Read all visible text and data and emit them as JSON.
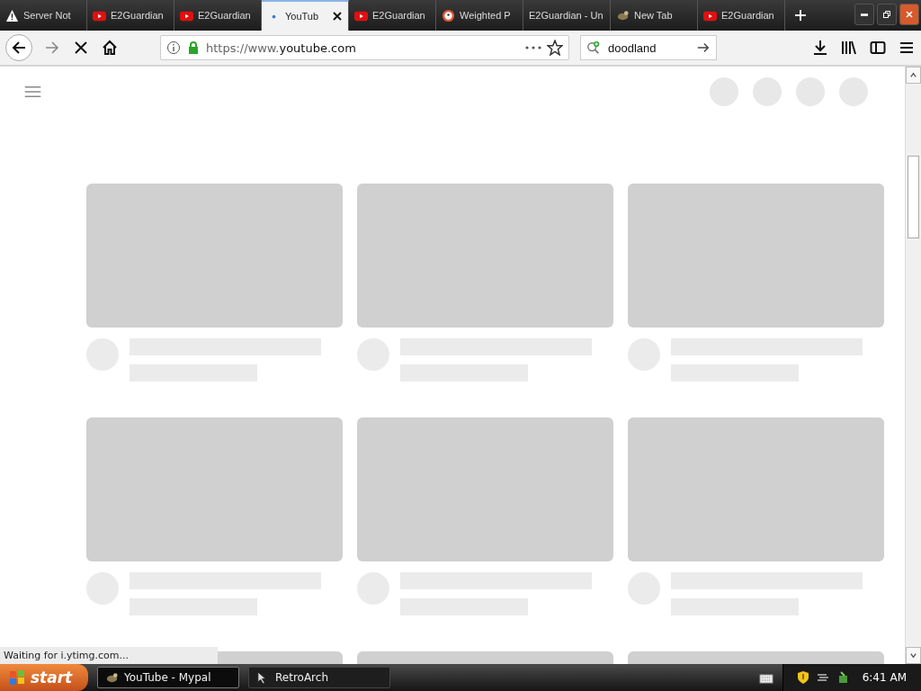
{
  "tabs": [
    {
      "label": "Server Not",
      "kind": "warning",
      "selected": false
    },
    {
      "label": "E2Guardian",
      "kind": "youtube",
      "selected": false
    },
    {
      "label": "E2Guardian",
      "kind": "youtube",
      "selected": false
    },
    {
      "label": "YouTub",
      "kind": "loading",
      "selected": true
    },
    {
      "label": "E2Guardian",
      "kind": "youtube",
      "selected": false
    },
    {
      "label": "Weighted P",
      "kind": "duck",
      "selected": false
    },
    {
      "label": "E2Guardian - Un",
      "kind": "plain",
      "selected": false
    },
    {
      "label": "New Tab",
      "kind": "critter",
      "selected": false
    },
    {
      "label": "E2Guardian",
      "kind": "youtube",
      "selected": false
    }
  ],
  "address": {
    "url_prefix": "https://www.",
    "url_domain": "youtube.com"
  },
  "search": {
    "value": "doodland"
  },
  "status": "Waiting for i.ytimg.com...",
  "taskbar": {
    "start": "start",
    "tasks": [
      {
        "label": "YouTube - Mypal",
        "kind": "critter",
        "selected": true
      },
      {
        "label": "RetroArch",
        "kind": "cursor",
        "selected": false
      }
    ],
    "clock": "6:41 AM"
  }
}
